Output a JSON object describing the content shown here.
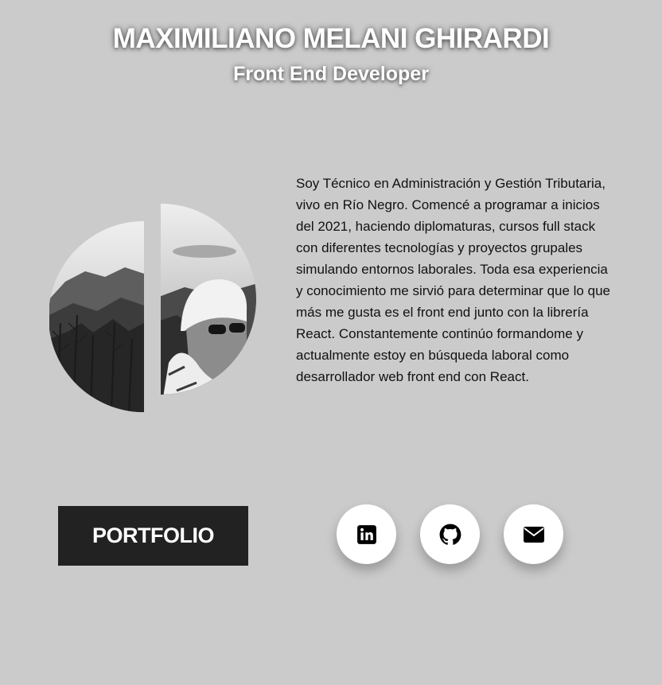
{
  "header": {
    "name": "MAXIMILIANO MELANI GHIRARDI",
    "role": "Front End Developer"
  },
  "profile": {
    "photo_icon": "profile-photo-split-circle",
    "bio": "Soy Técnico en Administración y Gestión Tributaria, vivo en Río Negro. Comencé a programar a inicios del 2021, haciendo diplomaturas, cursos full stack con diferentes tecnologías y proyectos grupales simulando entornos laborales. Toda esa experiencia y conocimiento me sirvió para determinar que lo que más me gusta es el front end junto con la librería React. Constantemente continúo formandome y actualmente estoy en búsqueda laboral como desarrollador web front end con React."
  },
  "actions": {
    "portfolio_label": "PORTFOLIO",
    "social": [
      {
        "icon": "linkedin-icon"
      },
      {
        "icon": "github-icon"
      },
      {
        "icon": "envelope-icon"
      }
    ]
  },
  "colors": {
    "background": "#cbcbcb",
    "button_dark": "#222222",
    "text": "#111111",
    "white": "#ffffff"
  }
}
